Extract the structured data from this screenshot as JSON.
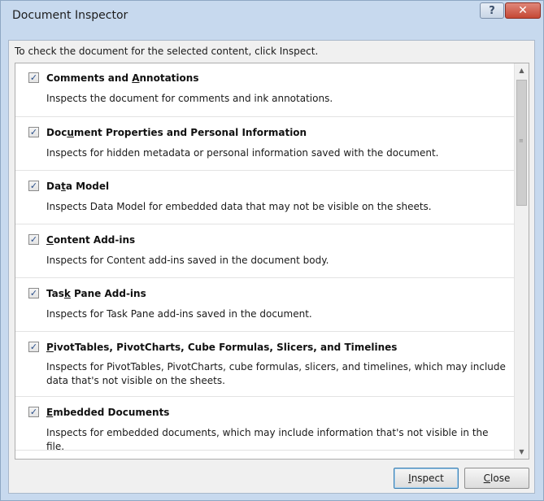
{
  "window": {
    "title": "Document Inspector",
    "help_glyph": "?",
    "close_glyph": "✕"
  },
  "instruction": "To check the document for the selected content, click Inspect.",
  "items": [
    {
      "checked": true,
      "heading_pre": "Comments and ",
      "heading_key": "A",
      "heading_post": "nnotations",
      "description": "Inspects the document for comments and ink annotations."
    },
    {
      "checked": true,
      "heading_pre": "Doc",
      "heading_key": "u",
      "heading_post": "ment Properties and Personal Information",
      "description": "Inspects for hidden metadata or personal information saved with the document."
    },
    {
      "checked": true,
      "heading_pre": "Da",
      "heading_key": "t",
      "heading_post": "a Model",
      "description": "Inspects Data Model for embedded data that may not be visible on the sheets."
    },
    {
      "checked": true,
      "heading_pre": "",
      "heading_key": "C",
      "heading_post": "ontent Add-ins",
      "description": "Inspects for Content add-ins saved in the document body."
    },
    {
      "checked": true,
      "heading_pre": "Tas",
      "heading_key": "k",
      "heading_post": " Pane Add-ins",
      "description": "Inspects for Task Pane add-ins saved in the document."
    },
    {
      "checked": true,
      "heading_pre": "",
      "heading_key": "P",
      "heading_post": "ivotTables, PivotCharts, Cube Formulas, Slicers, and Timelines",
      "description": "Inspects for PivotTables, PivotCharts, cube formulas, slicers, and timelines, which may include data that's not visible on the sheets."
    },
    {
      "checked": true,
      "heading_pre": "",
      "heading_key": "E",
      "heading_post": "mbedded Documents",
      "description": "Inspects for embedded documents, which may include information that's not visible in the file."
    }
  ],
  "buttons": {
    "inspect_key": "I",
    "inspect_rest": "nspect",
    "close_key": "C",
    "close_rest": "lose"
  },
  "icons": {
    "check": "check-icon",
    "scroll_up": "scroll-up-arrow-icon",
    "scroll_down": "scroll-down-arrow-icon",
    "help": "help-icon",
    "close": "close-icon"
  }
}
